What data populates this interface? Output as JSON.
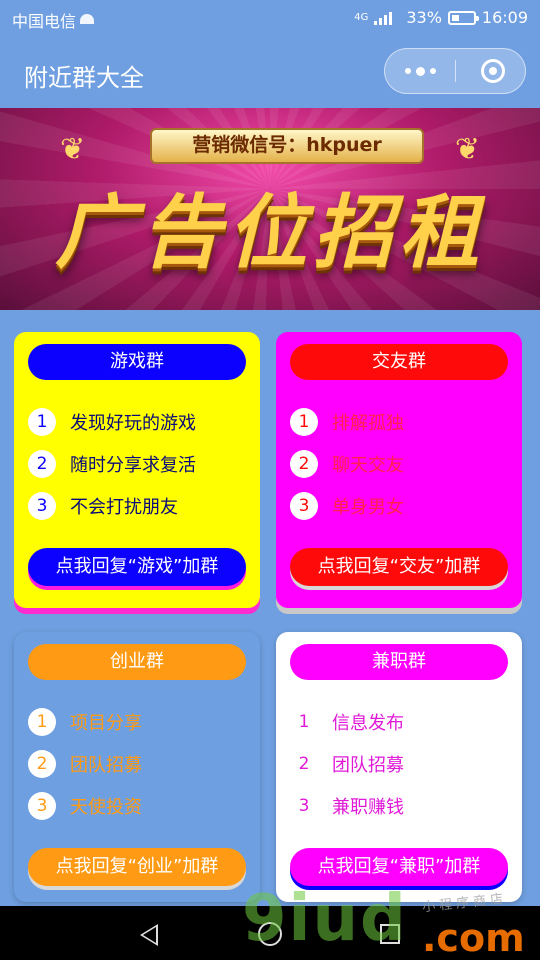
{
  "status_bar": {
    "carrier": "中国电信",
    "network": "4G",
    "battery": "33%",
    "time": "16:09"
  },
  "navbar": {
    "title": "附近群大全"
  },
  "banner": {
    "subtitle": "营销微信号：hkpuer",
    "headline": "广告位招租"
  },
  "cards": [
    {
      "title": "游戏群",
      "items": [
        {
          "num": "1",
          "text": "发现好玩的游戏"
        },
        {
          "num": "2",
          "text": "随时分享求复活"
        },
        {
          "num": "3",
          "text": "不会打扰朋友"
        }
      ],
      "button": "点我回复“游戏”加群"
    },
    {
      "title": "交友群",
      "items": [
        {
          "num": "1",
          "text": "排解孤独"
        },
        {
          "num": "2",
          "text": "聊天交友"
        },
        {
          "num": "3",
          "text": "单身男女"
        }
      ],
      "button": "点我回复“交友”加群"
    },
    {
      "title": "创业群",
      "items": [
        {
          "num": "1",
          "text": "项目分享"
        },
        {
          "num": "2",
          "text": "团队招募"
        },
        {
          "num": "3",
          "text": "天使投资"
        }
      ],
      "button": "点我回复“创业”加群"
    },
    {
      "title": "兼职群",
      "items": [
        {
          "num": "1",
          "text": "信息发布"
        },
        {
          "num": "2",
          "text": "团队招募"
        },
        {
          "num": "3",
          "text": "兼职赚钱"
        }
      ],
      "button": "点我回复“兼职”加群"
    }
  ],
  "watermark": {
    "main": "9iud",
    "tld": ".com",
    "tagline": "小程序商店"
  }
}
